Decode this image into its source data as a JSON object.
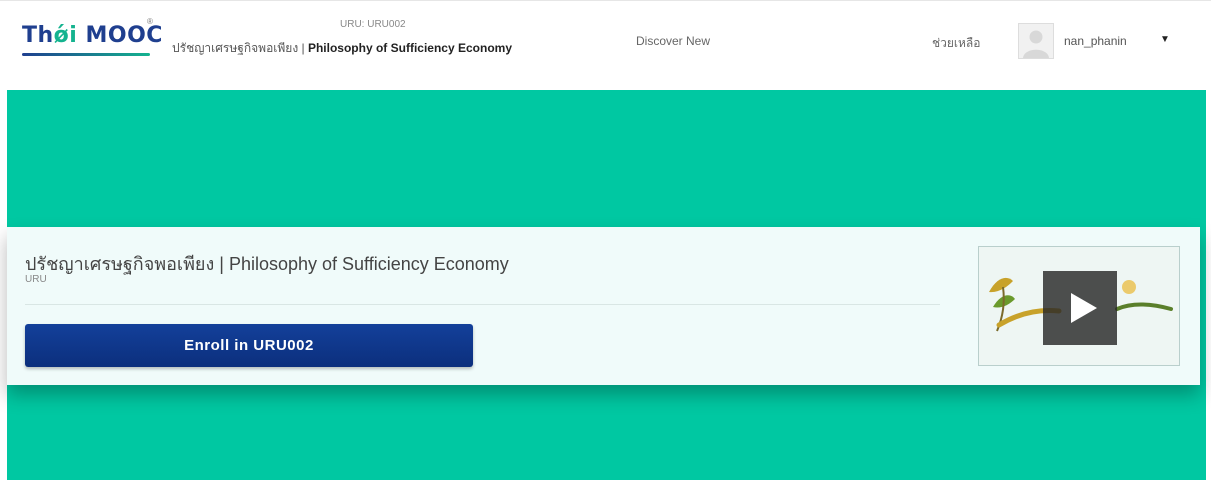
{
  "header": {
    "logo_prefix": "Th",
    "logo_accent": "ǿi",
    "logo_suffix": " MOOC",
    "logo_reg": "®",
    "course_code": "URU: URU002",
    "course_name_thai": "ปรัชญาเศรษฐกิจพอเพียง | ",
    "course_name_en": "Philosophy of Sufficiency Economy",
    "discover_label": "Discover New",
    "help_label": "ช่วยเหลือ",
    "username": "nan_phanin",
    "caret": "▼"
  },
  "course": {
    "title": "ปรัชญาเศรษฐกิจพอเพียง | Philosophy of Sufficiency Economy",
    "org": "URU",
    "enroll_label": "Enroll in URU002"
  },
  "icons": {
    "avatar": "user-avatar-icon",
    "play": "play-icon",
    "dropdown": "chevron-down-icon"
  },
  "colors": {
    "brand_blue": "#1f3f8f",
    "brand_green": "#14b38f",
    "hero_bg": "#00c8a2",
    "enroll_button": "#13409a"
  }
}
